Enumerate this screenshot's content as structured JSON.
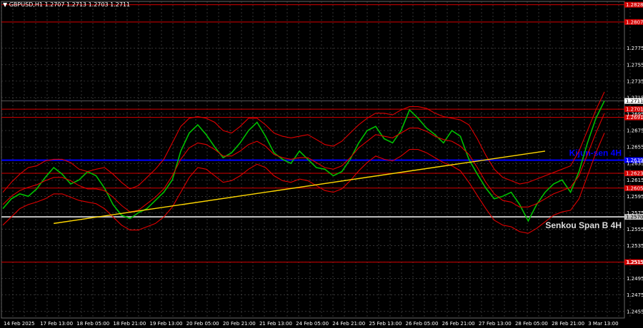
{
  "header": {
    "title": "▼ GBPUSD,H1  1.2707 1.2713 1.2703 1.2711"
  },
  "chart_data": {
    "type": "line",
    "symbol": "GBPUSD,H1",
    "ohlc": {
      "open": 1.2707,
      "high": 1.2713,
      "low": 1.2703,
      "close": 1.2711
    },
    "ylim": [
      1.2447,
      1.2832
    ],
    "y_ticks": [
      {
        "v": 1.2775,
        "label": "1.2775"
      },
      {
        "v": 1.2755,
        "label": "1.2755"
      },
      {
        "v": 1.2735,
        "label": "1.2735"
      },
      {
        "v": 1.2715,
        "label": "1.2715"
      },
      {
        "v": 1.2695,
        "label": "1.2695"
      },
      {
        "v": 1.2675,
        "label": "1.2675"
      },
      {
        "v": 1.2655,
        "label": "1.2655"
      },
      {
        "v": 1.2635,
        "label": "1.2635"
      },
      {
        "v": 1.2615,
        "label": "1.2615"
      },
      {
        "v": 1.2595,
        "label": "1.2595"
      },
      {
        "v": 1.2575,
        "label": "1.2575"
      },
      {
        "v": 1.2555,
        "label": "1.2555"
      },
      {
        "v": 1.2535,
        "label": "1.2535"
      },
      {
        "v": 1.2515,
        "label": "1.2515"
      },
      {
        "v": 1.2495,
        "label": "1.2495"
      },
      {
        "v": 1.2475,
        "label": "1.2475"
      },
      {
        "v": 1.2455,
        "label": "1.2455"
      }
    ],
    "x_labels": [
      "14 Feb 2025",
      "17 Feb 13:00",
      "18 Feb 05:00",
      "18 Feb 21:00",
      "19 Feb 13:00",
      "20 Feb 05:00",
      "20 Feb 21:00",
      "21 Feb 13:00",
      "24 Feb 05:00",
      "24 Feb 21:00",
      "25 Feb 13:00",
      "26 Feb 05:00",
      "26 Feb 21:00",
      "27 Feb 13:00",
      "28 Feb 05:00",
      "28 Feb 21:00",
      "3 Mar 13:00"
    ],
    "price_levels": [
      {
        "v": 1.2828,
        "label": "1.2828",
        "color": "#d40000"
      },
      {
        "v": 1.2807,
        "label": "1.2807",
        "color": "#d40000"
      },
      {
        "v": 1.2701,
        "label": "1.2701",
        "color": "#d40000"
      },
      {
        "v": 1.2691,
        "label": "1.2691",
        "color": "#d40000"
      },
      {
        "v": 1.2623,
        "label": "1.2623",
        "color": "#d40000"
      },
      {
        "v": 1.2605,
        "label": "1.2605",
        "color": "#d40000"
      },
      {
        "v": 1.2515,
        "label": "1.2515",
        "color": "#d40000"
      }
    ],
    "kijun_sen": {
      "v": 1.2639,
      "label": "Kijun-sen 4H",
      "value_label": "1.2639",
      "color": "#0000ff"
    },
    "senkou_span_b": {
      "v": 1.257,
      "label": "Senkou Span B 4H",
      "value_label": "1.2570",
      "color": "#c0c0c0"
    },
    "current_price": {
      "v": 1.2711,
      "label": "1.2711"
    },
    "trendline": {
      "from": [
        6,
        1.2562
      ],
      "to": [
        64,
        1.265
      ],
      "color": "#ffd700"
    },
    "series": [
      {
        "name": "price",
        "color": "#00c000",
        "values": [
          1.258,
          1.2592,
          1.2598,
          1.2595,
          1.2604,
          1.2618,
          1.263,
          1.2622,
          1.261,
          1.2615,
          1.2625,
          1.262,
          1.2605,
          1.2585,
          1.2572,
          1.2568,
          1.2575,
          1.258,
          1.259,
          1.26,
          1.2615,
          1.265,
          1.2672,
          1.2682,
          1.267,
          1.2655,
          1.2642,
          1.2648,
          1.266,
          1.2675,
          1.2685,
          1.2668,
          1.2648,
          1.264,
          1.2635,
          1.265,
          1.264,
          1.263,
          1.2628,
          1.262,
          1.2625,
          1.264,
          1.266,
          1.2675,
          1.268,
          1.2665,
          1.266,
          1.2675,
          1.27,
          1.269,
          1.2678,
          1.267,
          1.266,
          1.2675,
          1.2668,
          1.264,
          1.2622,
          1.2605,
          1.2592,
          1.2595,
          1.26,
          1.2585,
          1.2565,
          1.2585,
          1.26,
          1.261,
          1.2615,
          1.26,
          1.2625,
          1.266,
          1.269,
          1.2711
        ]
      },
      {
        "name": "ichimoku-upper",
        "color": "#e00000",
        "values": [
          1.26,
          1.2612,
          1.2622,
          1.263,
          1.2632,
          1.2638,
          1.264,
          1.264,
          1.2636,
          1.2628,
          1.2625,
          1.2628,
          1.263,
          1.2622,
          1.2612,
          1.2604,
          1.2608,
          1.2618,
          1.2628,
          1.264,
          1.266,
          1.268,
          1.269,
          1.2692,
          1.269,
          1.2685,
          1.2675,
          1.2672,
          1.268,
          1.269,
          1.269,
          1.2682,
          1.2672,
          1.2668,
          1.2666,
          1.2668,
          1.267,
          1.2664,
          1.2658,
          1.2656,
          1.2662,
          1.2672,
          1.2682,
          1.269,
          1.2696,
          1.2696,
          1.2694,
          1.27,
          1.2704,
          1.2704,
          1.2702,
          1.2696,
          1.2692,
          1.269,
          1.2688,
          1.2682,
          1.2665,
          1.2645,
          1.2628,
          1.2618,
          1.2614,
          1.261,
          1.2612,
          1.2616,
          1.262,
          1.2624,
          1.2628,
          1.2632,
          1.265,
          1.2675,
          1.27,
          1.2722
        ]
      },
      {
        "name": "ichimoku-lower",
        "color": "#e00000",
        "values": [
          1.256,
          1.257,
          1.258,
          1.2585,
          1.2588,
          1.2592,
          1.2598,
          1.2598,
          1.2594,
          1.259,
          1.2588,
          1.2586,
          1.258,
          1.257,
          1.256,
          1.2554,
          1.2554,
          1.2558,
          1.2562,
          1.257,
          1.2582,
          1.26,
          1.2618,
          1.263,
          1.2628,
          1.262,
          1.2612,
          1.2614,
          1.262,
          1.2628,
          1.2634,
          1.263,
          1.262,
          1.2614,
          1.2612,
          1.2616,
          1.2614,
          1.2608,
          1.2602,
          1.26,
          1.2604,
          1.2614,
          1.2626,
          1.2636,
          1.2644,
          1.264,
          1.2638,
          1.2644,
          1.2652,
          1.2652,
          1.2648,
          1.2642,
          1.2636,
          1.2632,
          1.2626,
          1.2612,
          1.2596,
          1.258,
          1.2566,
          1.256,
          1.2558,
          1.2552,
          1.255,
          1.2556,
          1.2564,
          1.2572,
          1.2576,
          1.2578,
          1.2592,
          1.262,
          1.2648,
          1.2672
        ]
      },
      {
        "name": "ichimoku-mid",
        "color": "#e00000",
        "values": [
          1.2585,
          1.2595,
          1.2602,
          1.2606,
          1.2609,
          1.2614,
          1.2618,
          1.2618,
          1.2614,
          1.2608,
          1.2604,
          1.2604,
          1.2602,
          1.2594,
          1.2584,
          1.2576,
          1.2578,
          1.2586,
          1.2594,
          1.2604,
          1.262,
          1.264,
          1.2654,
          1.266,
          1.2658,
          1.2652,
          1.2644,
          1.2644,
          1.265,
          1.2658,
          1.2662,
          1.2656,
          1.2646,
          1.2642,
          1.264,
          1.2642,
          1.2642,
          1.2636,
          1.263,
          1.2628,
          1.2632,
          1.2642,
          1.2654,
          1.2662,
          1.267,
          1.2668,
          1.2666,
          1.2672,
          1.2678,
          1.2678,
          1.2674,
          1.2668,
          1.2664,
          1.2662,
          1.2656,
          1.2646,
          1.263,
          1.2612,
          1.2598,
          1.259,
          1.2588,
          1.2582,
          1.2582,
          1.2586,
          1.2592,
          1.2598,
          1.2602,
          1.2606,
          1.262,
          1.2646,
          1.2672,
          1.2696
        ]
      }
    ]
  }
}
